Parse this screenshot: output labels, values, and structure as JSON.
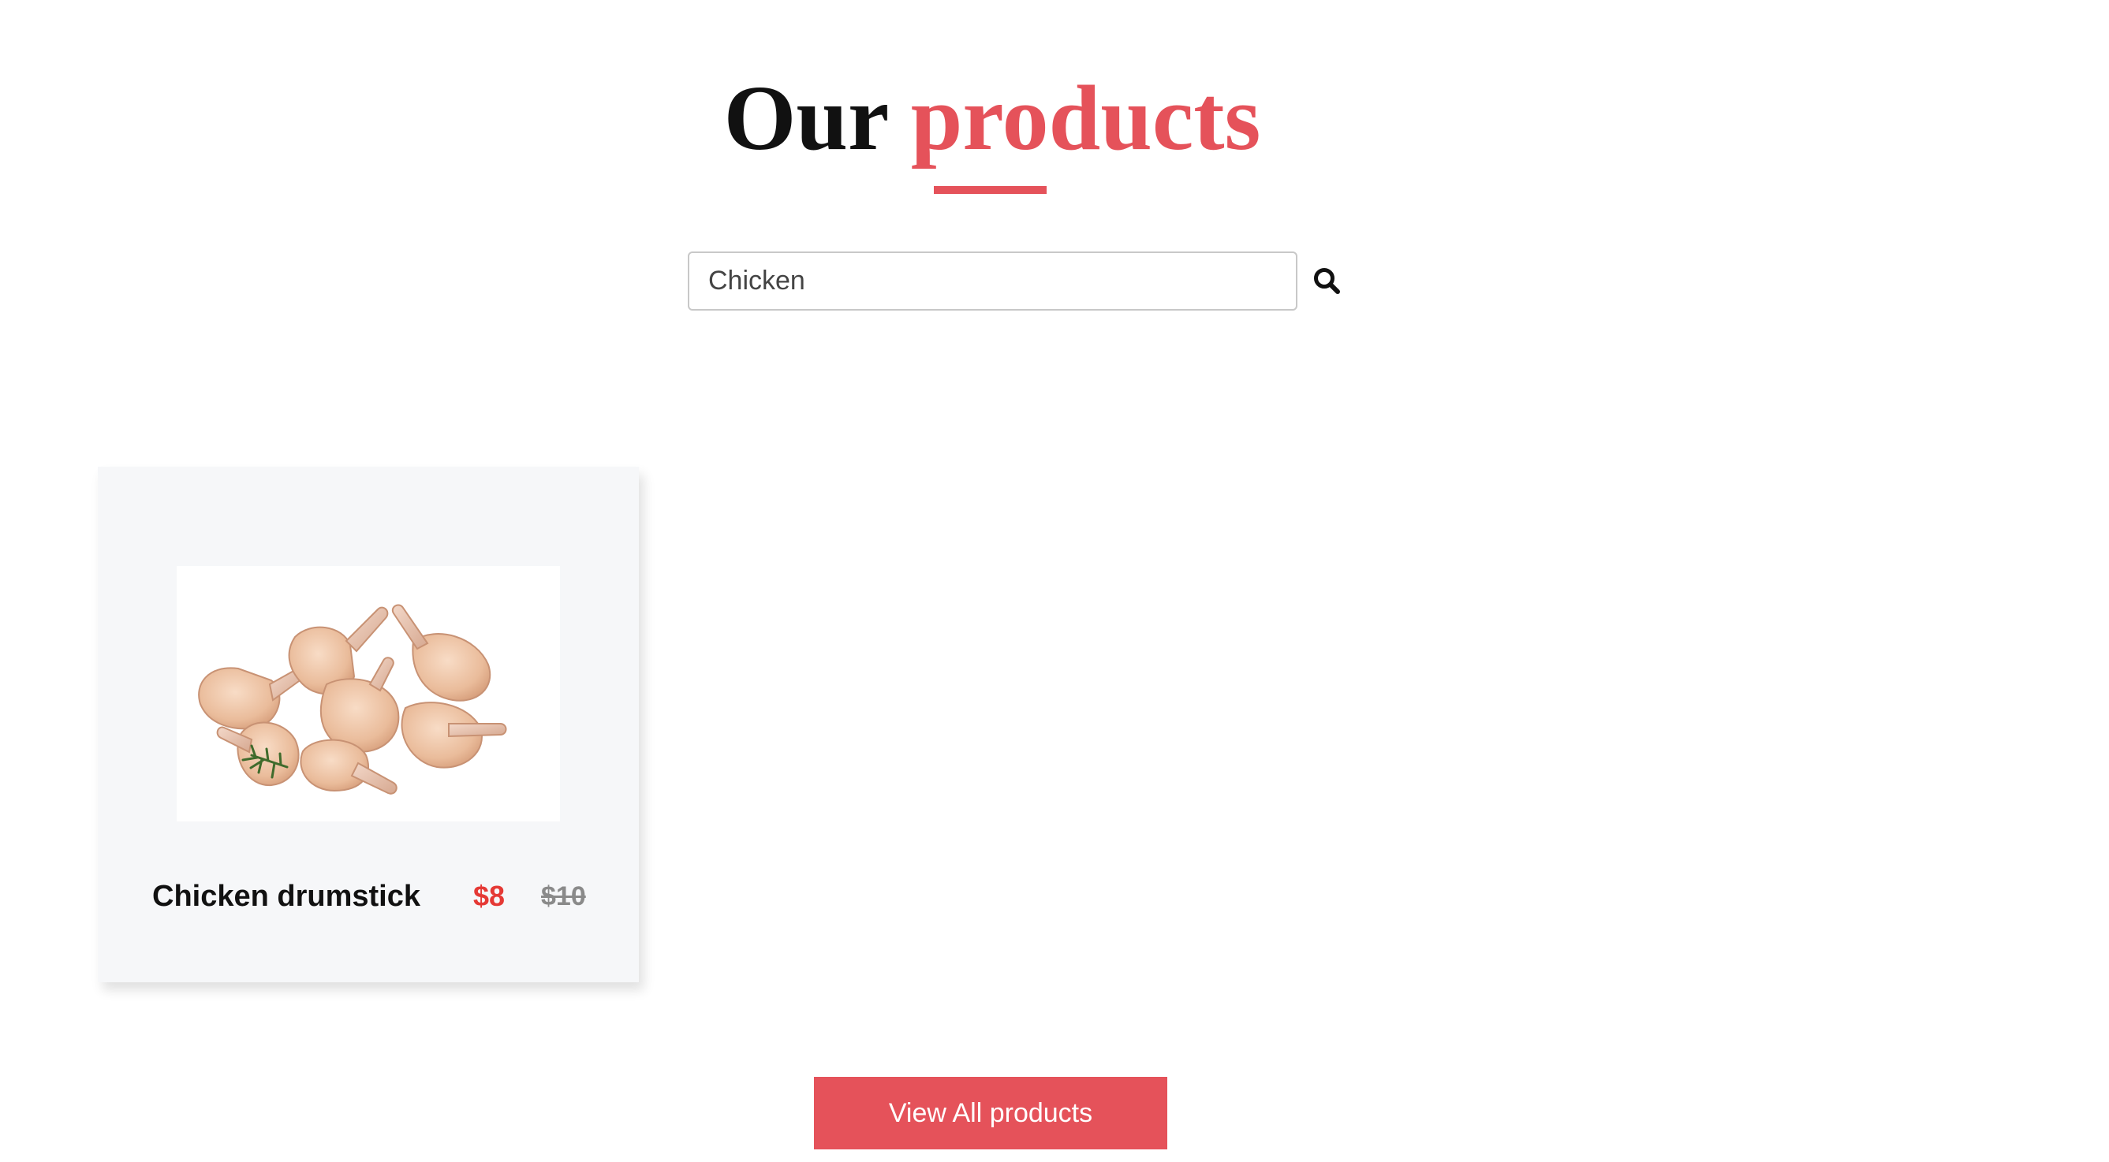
{
  "section": {
    "title_plain": "Our",
    "title_accent": "products",
    "accent_color": "#e5525a"
  },
  "search": {
    "value": "Chicken",
    "icon": "search-icon"
  },
  "products": [
    {
      "name": "Chicken drumstick",
      "price": "$8",
      "old_price": "$10",
      "image_icon": "chicken-drumsticks-image"
    }
  ],
  "footer": {
    "view_all_label": "View All products"
  },
  "colors": {
    "accent": "#e5525a",
    "price": "#e53935",
    "old_price": "#8a8a8a",
    "card_background": "#f6f7f9"
  }
}
